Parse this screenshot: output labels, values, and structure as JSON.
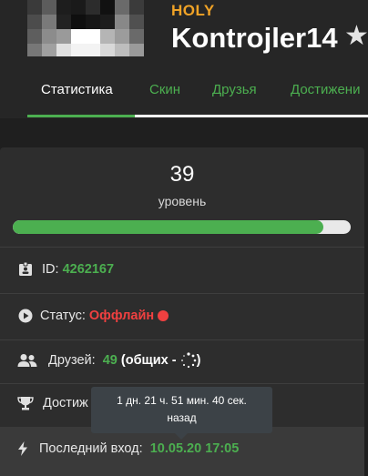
{
  "profile": {
    "rank": "HOLY",
    "nickname": "Kontrojler14",
    "avatar_pixels": [
      "#3a3a3a",
      "#5c5c5c",
      "#1d1d1d",
      "#1a1a1a",
      "#2c2c2c",
      "#111111",
      "#6a6a6a",
      "#3b3b3b",
      "#4c4c4c",
      "#7a7a7a",
      "#222222",
      "#0f0f0f",
      "#161616",
      "#1c1c1c",
      "#888888",
      "#505050",
      "#5e5e5e",
      "#8c8c8c",
      "#9a9a9a",
      "#ffffff",
      "#ffffff",
      "#b5b5b5",
      "#9c9c9c",
      "#6a6a6a",
      "#777777",
      "#a0a0a0",
      "#e0e0e0",
      "#f3f3f3",
      "#f3f3f3",
      "#d8d8d8",
      "#bdbdbd",
      "#9a9a9a"
    ]
  },
  "tabs": [
    {
      "label": "Статистика",
      "active": true
    },
    {
      "label": "Скин",
      "active": false
    },
    {
      "label": "Друзья",
      "active": false
    },
    {
      "label": "Достижени",
      "active": false
    }
  ],
  "stats": {
    "level_value": "39",
    "level_label": "уровень",
    "level_progress": 0.92,
    "id_label": "ID:",
    "id_value": "4262167",
    "status_label": "Статус:",
    "status_value": "Оффлайн",
    "friends_label": "Друзей:",
    "friends_value": "49",
    "friends_common_open": "(общих -",
    "friends_common_close": ")",
    "achievements_label": "Достиж",
    "last_login_label": "Последний вход:",
    "last_login_value": "10.05.20 17:05"
  },
  "tooltip": {
    "line1": "1 дн. 21 ч. 51 мин. 40 сек.",
    "line2": "назад"
  },
  "colors": {
    "accent_green": "#4caf50",
    "rank_gold": "#f0a326",
    "offline_red": "#f04040"
  },
  "icons": [
    "id-card-icon",
    "play-circle-icon",
    "users-icon",
    "trophy-icon",
    "bolt-icon",
    "star-icon",
    "spinner-icon"
  ]
}
